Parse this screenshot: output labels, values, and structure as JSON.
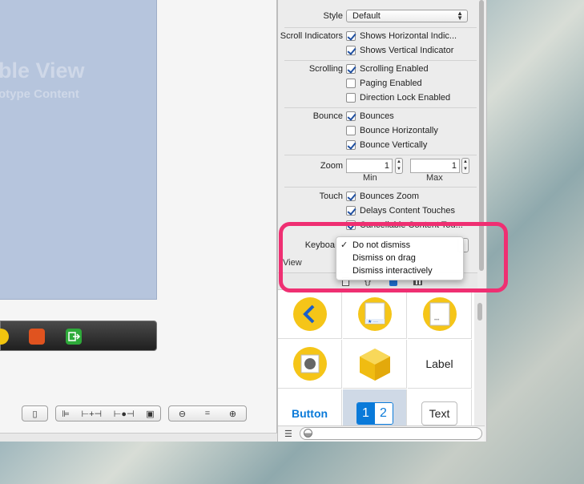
{
  "canvas": {
    "table_view_title": "ble View",
    "table_view_subtitle": "otype Content"
  },
  "inspector": {
    "style": {
      "label": "Style",
      "value": "Default"
    },
    "scroll_indicators": {
      "label": "Scroll Indicators",
      "items": [
        {
          "label": "Shows Horizontal Indic...",
          "checked": true
        },
        {
          "label": "Shows Vertical Indicator",
          "checked": true
        }
      ]
    },
    "scrolling": {
      "label": "Scrolling",
      "items": [
        {
          "label": "Scrolling Enabled",
          "checked": true
        },
        {
          "label": "Paging Enabled",
          "checked": false
        },
        {
          "label": "Direction Lock Enabled",
          "checked": false
        }
      ]
    },
    "bounce": {
      "label": "Bounce",
      "items": [
        {
          "label": "Bounces",
          "checked": true
        },
        {
          "label": "Bounce Horizontally",
          "checked": false
        },
        {
          "label": "Bounce Vertically",
          "checked": true
        }
      ]
    },
    "zoom": {
      "label": "Zoom",
      "min_value": "1",
      "max_value": "1",
      "min_label": "Min",
      "max_label": "Max"
    },
    "touch": {
      "label": "Touch",
      "items": [
        {
          "label": "Bounces Zoom",
          "checked": true
        },
        {
          "label": "Delays Content Touches",
          "checked": true
        },
        {
          "label": "Cancellable Content Tou...",
          "checked": true
        }
      ]
    },
    "keyboard": {
      "label": "Keyboa"
    },
    "next_section": "View"
  },
  "keyboard_menu": {
    "checkmark": "✓",
    "items": [
      "Do not dismiss",
      "Dismiss on drag",
      "Dismiss interactively"
    ],
    "selected": "Do not dismiss"
  },
  "library": {
    "tabs_icons": [
      "file-icon",
      "braces-icon",
      "cube-icon",
      "media-icon"
    ],
    "label_cell": "Label",
    "button_cell": "Button",
    "segment_1": "1",
    "segment_2": "2",
    "text_cell": "Text"
  },
  "colors": {
    "highlight": "#ef2f72",
    "object_yellow": "#f5c518",
    "ios_blue": "#0a7ad9"
  }
}
